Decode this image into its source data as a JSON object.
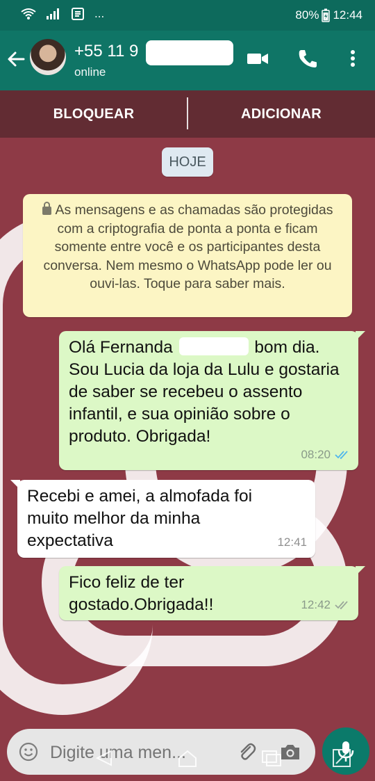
{
  "status_bar": {
    "battery": "80%",
    "time": "12:44",
    "more": "..."
  },
  "header": {
    "contact_name": "+55 11 9",
    "status": "online"
  },
  "actions": {
    "block": "BLOQUEAR",
    "add": "ADICIONAR"
  },
  "chat": {
    "date_chip": "HOJE",
    "encryption_notice": "As mensagens e as chamadas são protegidas com a criptografia de ponta a ponta e ficam somente entre você e os participantes desta conversa. Nem mesmo o WhatsApp pode ler ou ouvi-las. Toque para saber mais.",
    "messages": [
      {
        "direction": "out",
        "text_before_name": "Olá Fernanda ",
        "text_after_name": " bom dia. Sou Lucia da loja da Lulu e gostaria de saber se recebeu o assento infantil, e sua opinião sobre o produto. Obrigada!",
        "time": "08:20",
        "read": true
      },
      {
        "direction": "in",
        "text": "Recebi e amei, a almofada foi muito melhor da minha expectativa",
        "time": "12:41"
      },
      {
        "direction": "out",
        "text": "Fico feliz de ter gostado.Obrigada!!",
        "time": "12:42",
        "read": false
      }
    ]
  },
  "composer": {
    "placeholder": "Digite uma men..."
  },
  "colors": {
    "header": "#0f7566",
    "outgoing_bubble": "#dcf8c6",
    "notice_bg": "#fcf5c4",
    "wallpaper": "#8e3a46",
    "read_ticks": "#4fb6ec"
  }
}
